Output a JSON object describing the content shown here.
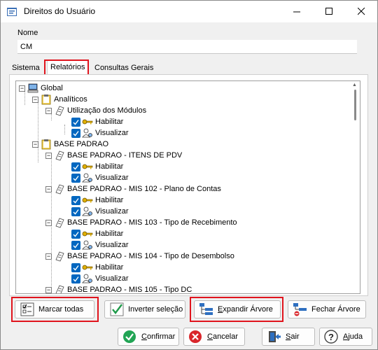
{
  "window": {
    "title": "Direitos do Usuário"
  },
  "form": {
    "name_label": "Nome",
    "name_value": "CM"
  },
  "tabs": [
    {
      "label": "Sistema",
      "active": false
    },
    {
      "label": "Relatórios",
      "active": true
    },
    {
      "label": "Consultas Gerais",
      "active": false
    }
  ],
  "tree": {
    "root": "Global",
    "groups": [
      {
        "label": "Analíticos"
      },
      {
        "label": "BASE PADRAO"
      }
    ],
    "reports": [
      {
        "label": "Utilização dos Módulos"
      },
      {
        "label": "BASE PADRAO - ITENS DE PDV"
      },
      {
        "label": "BASE PADRAO - MIS 102 - Plano de Contas"
      },
      {
        "label": "BASE PADRAO - MIS 103 - Tipo de Recebimento"
      },
      {
        "label": "BASE PADRAO - MIS 104 - Tipo de Desembolso"
      },
      {
        "label": "BASE PADRAO - MIS 105 - Tipo DC"
      }
    ],
    "permissions": {
      "enable": "Habilitar",
      "view": "Visualizar"
    }
  },
  "tree_actions": {
    "mark_all": "Marcar todas",
    "invert": "Inverter seleção",
    "expand": "Expandir Árvore",
    "collapse": "Fechar Árvore"
  },
  "footer": {
    "confirm": "Confirmar",
    "cancel": "Cancelar",
    "exit": "Sair",
    "help": "Ajuda"
  },
  "colors": {
    "highlight": "#e0141d",
    "checkbox": "#0067c0"
  }
}
